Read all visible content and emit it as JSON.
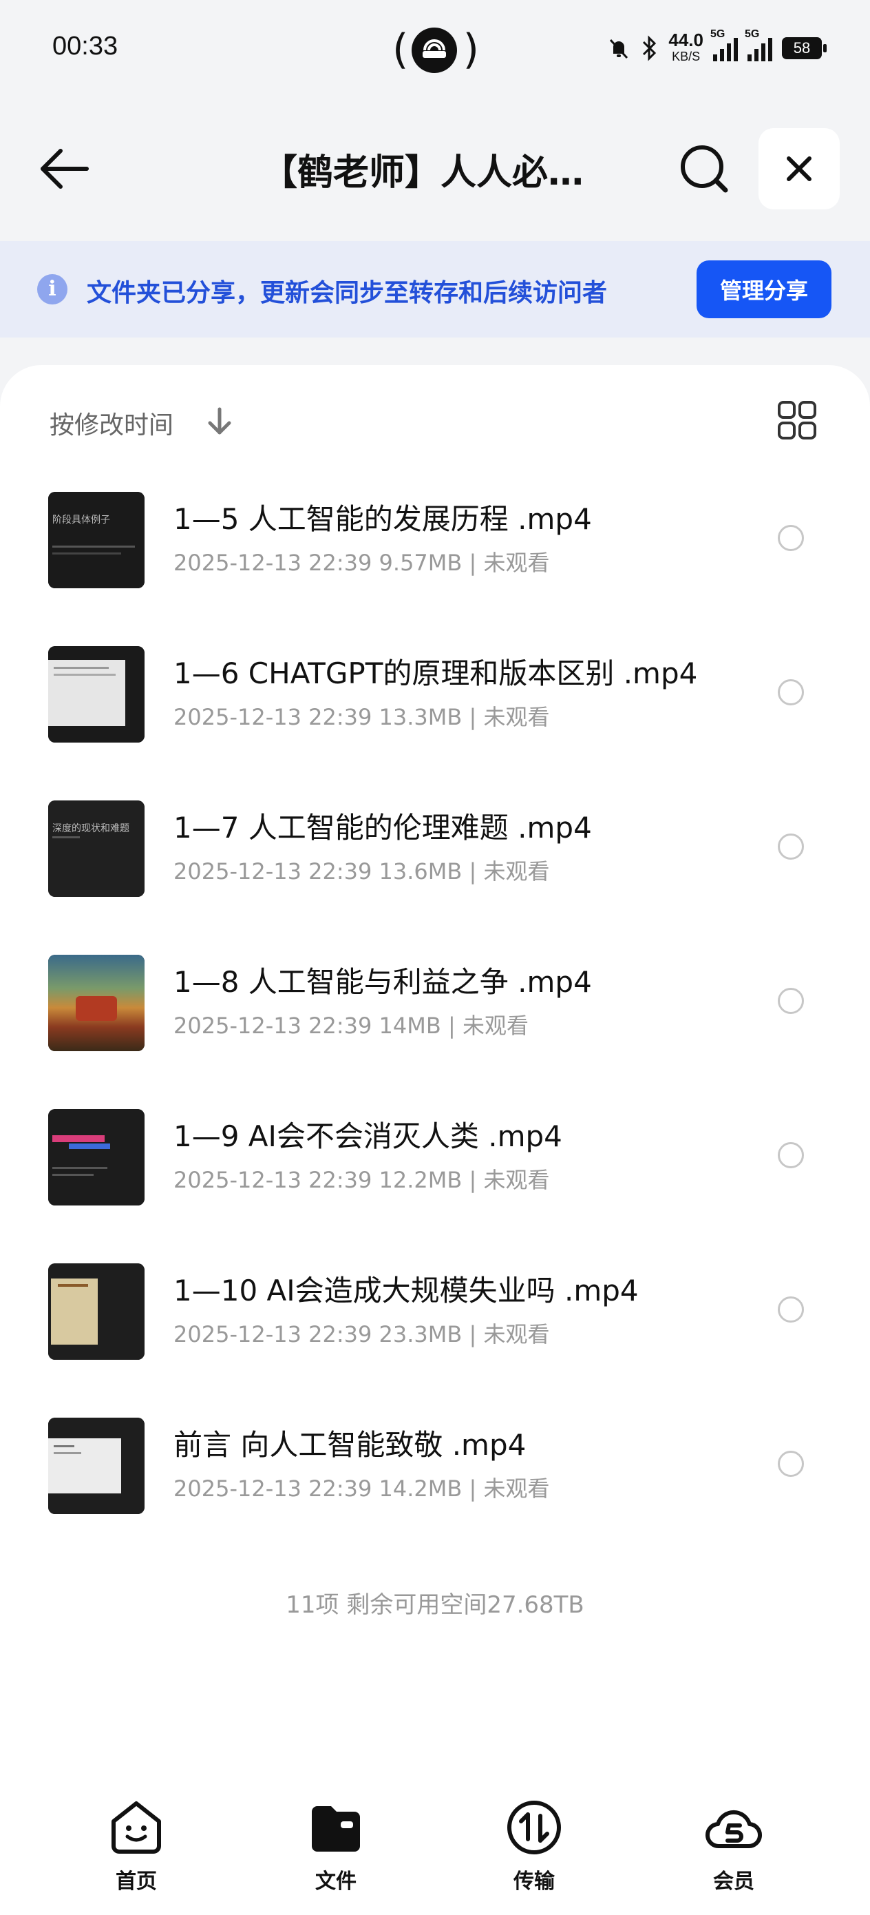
{
  "status_bar": {
    "time": "00:33",
    "net_speed": "44.0",
    "net_unit": "KB/S",
    "signal_1_label": "5G",
    "signal_2_label": "5G",
    "battery": "58"
  },
  "header": {
    "title": "【鹤老师】人人必…"
  },
  "share_banner": {
    "text": "文件夹已分享，更新会同步至转存和后续访问者",
    "button": "管理分享"
  },
  "list": {
    "sort_label": "按修改时间",
    "items": [
      {
        "name": "1—5 人工智能的发展历程 .mp4",
        "meta": "2025-12-13 22:39  9.57MB | 未观看",
        "thumb_text": "阶段具体例子"
      },
      {
        "name": "1—6 CHATGPT的原理和版本区别 .mp4",
        "meta": "2025-12-13 22:39  13.3MB | 未观看",
        "thumb_text": ""
      },
      {
        "name": "1—7 人工智能的伦理难题 .mp4",
        "meta": "2025-12-13 22:39  13.6MB | 未观看",
        "thumb_text": "深度的现状和难题"
      },
      {
        "name": "1—8 人工智能与利益之争 .mp4",
        "meta": "2025-12-13 22:39  14MB | 未观看",
        "thumb_text": ""
      },
      {
        "name": "1—9 AI会不会消灭人类 .mp4",
        "meta": "2025-12-13 22:39  12.2MB | 未观看",
        "thumb_text": ""
      },
      {
        "name": "1—10 AI会造成大规模失业吗 .mp4",
        "meta": "2025-12-13 22:39  23.3MB | 未观看",
        "thumb_text": ""
      },
      {
        "name": "前言 向人工智能致敬 .mp4",
        "meta": "2025-12-13 22:39  14.2MB | 未观看",
        "thumb_text": ""
      }
    ],
    "footer": "11项 剩余可用空间27.68TB"
  },
  "tabbar": {
    "home": "首页",
    "files": "文件",
    "transfer": "传输",
    "vip": "会员"
  },
  "colors": {
    "accent": "#1656f5",
    "banner_bg": "#e8ecf8",
    "banner_text": "#2350d9"
  }
}
